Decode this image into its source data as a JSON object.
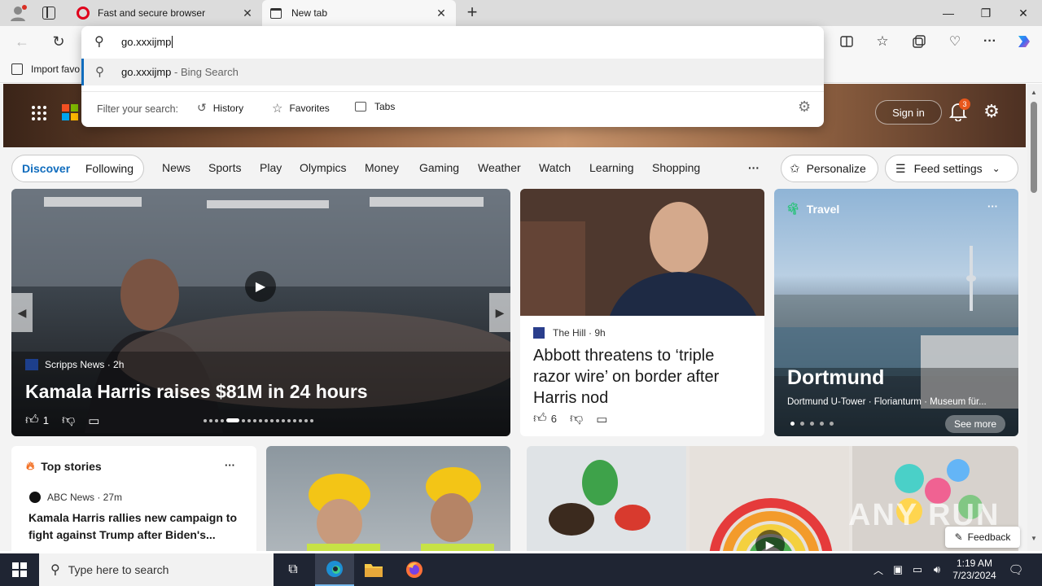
{
  "browser": {
    "tabs": [
      {
        "title": "Fast and secure browser",
        "icon": "opera-icon"
      },
      {
        "title": "New tab",
        "icon": "newtab-icon"
      }
    ],
    "address_input": "go.xxxijmp",
    "favorites_bar": {
      "import_label": "Import favo"
    }
  },
  "omnibox": {
    "suggestion_query": "go.xxxijmp",
    "suggestion_suffix": " - Bing Search",
    "filter_label": "Filter your search:",
    "filters": [
      "History",
      "Favorites",
      "Tabs"
    ]
  },
  "msn_header": {
    "sign_in": "Sign in",
    "notification_count": "3"
  },
  "nav": {
    "discover": "Discover",
    "following": "Following",
    "items": [
      "News",
      "Sports",
      "Play",
      "Olympics",
      "Money",
      "Gaming",
      "Weather",
      "Watch",
      "Learning",
      "Shopping"
    ],
    "more": "···",
    "personalize": "Personalize",
    "feed_settings": "Feed settings"
  },
  "hero_card": {
    "source": "Scripps News · 2h",
    "headline": "Kamala Harris raises $81M in 24 hours",
    "likes": "1"
  },
  "news_card": {
    "source": "The Hill · 9h",
    "headline": "Abbott threatens to ‘triple razor wire’ on border after Harris nod",
    "likes": "6"
  },
  "travel_card": {
    "category": "Travel",
    "title": "Dortmund",
    "subtitle": "Dortmund U-Tower · Florianturm · Museum für...",
    "see_more": "See more",
    "menu": "···"
  },
  "top_stories": {
    "title": "Top stories",
    "menu": "···",
    "source": "ABC News · 27m",
    "headline": "Kamala Harris rallies new campaign to fight against Trump after Biden's..."
  },
  "feedback": "Feedback",
  "watermark": "ANY RUN",
  "taskbar": {
    "search_placeholder": "Type here to search",
    "time": "1:19 AM",
    "date": "7/23/2024"
  },
  "colors": {
    "accent": "#0f6cbd",
    "taskbar": "#1f2533",
    "notification_badge": "#e8571c"
  }
}
